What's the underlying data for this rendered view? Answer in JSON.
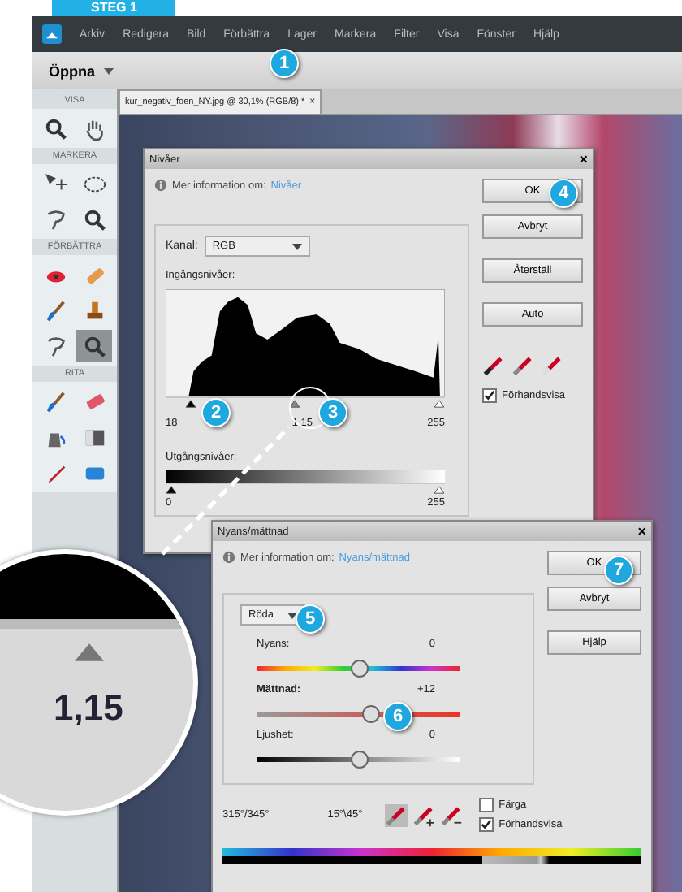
{
  "step_label": "STEG 1",
  "menu_bar": {
    "items": [
      "Arkiv",
      "Redigera",
      "Bild",
      "Förbättra",
      "Lager",
      "Markera",
      "Filter",
      "Visa",
      "Fönster",
      "Hjälp"
    ]
  },
  "toolbar": {
    "open_button": "Öppna"
  },
  "tool_panel": {
    "sections": [
      {
        "label": "VISA",
        "tools": [
          {
            "selected": false
          },
          {
            "selected": false
          }
        ]
      },
      {
        "label": "MARKERA",
        "tools": [
          {
            "selected": false
          },
          {
            "selected": false
          },
          {
            "selected": false
          },
          {
            "selected": false
          }
        ]
      },
      {
        "label": "FÖRBÄTTRA",
        "tools": [
          {
            "selected": false
          },
          {
            "selected": false
          },
          {
            "selected": false
          },
          {
            "selected": false
          },
          {
            "selected": false
          },
          {
            "selected": true
          }
        ]
      },
      {
        "label": "RITA",
        "tools": [
          {
            "selected": false
          },
          {
            "selected": false
          },
          {
            "selected": false
          },
          {
            "selected": false
          },
          {
            "selected": false
          },
          {
            "selected": false
          }
        ]
      }
    ]
  },
  "document_tab": {
    "title": "kur_negativ_foen_NY.jpg @ 30,1% (RGB/8) *",
    "close": "×"
  },
  "levels_dialog": {
    "title": "Nivåer",
    "close": "×",
    "info_text": "Mer information om:",
    "info_link": "Nivåer",
    "channel_label": "Kanal:",
    "channel_value": "RGB",
    "input_label": "Ingångsnivåer:",
    "input_sliders": [
      {
        "level": 0.07
      },
      {
        "level": 0.46
      },
      {
        "level": 1
      }
    ],
    "input_values": [
      "18",
      "1,15",
      "255"
    ],
    "output_label": "Utgångsnivåer:",
    "output_sliders": [
      {
        "level": 0
      },
      {
        "level": 1
      }
    ],
    "output_values": [
      "0",
      "255"
    ],
    "buttons": [
      "OK",
      "Avbryt",
      "Återställ",
      "Auto"
    ],
    "preview": {
      "label": "Förhandsvisa",
      "checked": true
    }
  },
  "hue_dialog": {
    "title": "Nyans/mättnad",
    "close": "×",
    "info_text": "Mer information om:",
    "info_link": "Nyans/mättnad",
    "edit_value": "Röda",
    "sliders": [
      {
        "kind": "hue",
        "label": "Nyans:",
        "reading": "0",
        "level": 0.5,
        "bold": false
      },
      {
        "kind": "saturation",
        "label": "Mättnad:",
        "reading": "+12",
        "level": 0.56,
        "bold": true
      },
      {
        "kind": "lightness",
        "label": "Ljushet:",
        "reading": "0",
        "level": 0.5,
        "bold": false
      }
    ],
    "range_left": "315°/345°",
    "range_right": "15°\\45°",
    "buttons": [
      "OK",
      "Avbryt",
      "Hjälp"
    ],
    "checkboxes": [
      {
        "label": "Färga",
        "checked": false
      },
      {
        "label": "Förhandsvisa",
        "checked": true
      }
    ]
  },
  "magnifier": {
    "value": "1,15"
  },
  "callouts": [
    "1",
    "2",
    "3",
    "4",
    "5",
    "6",
    "7"
  ]
}
